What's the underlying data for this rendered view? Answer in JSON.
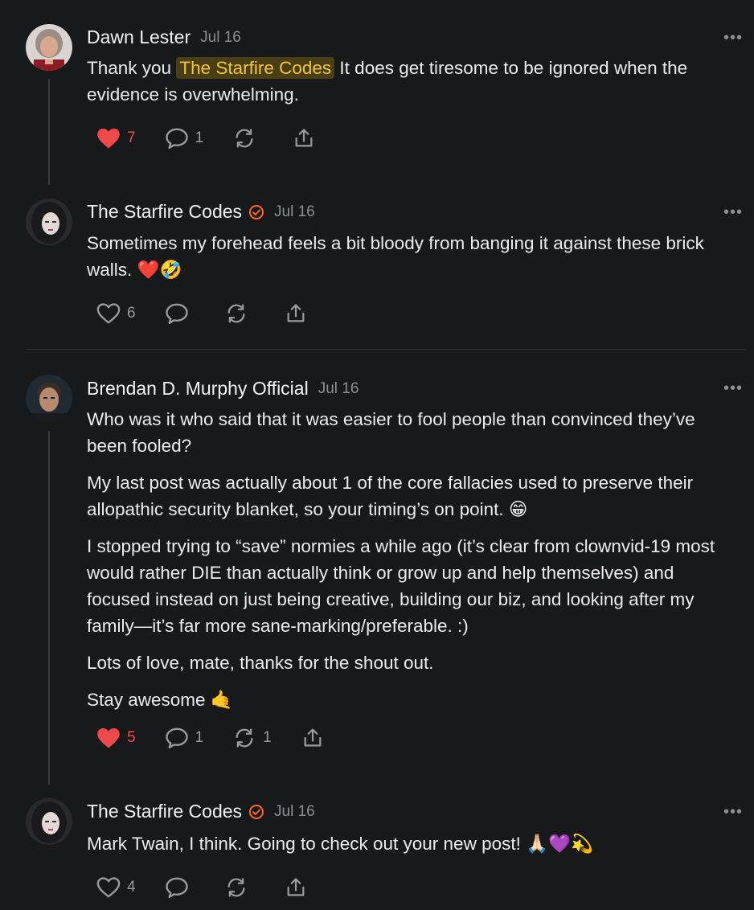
{
  "comments": [
    {
      "author": "Dawn Lester",
      "date": "Jul 16",
      "body_prefix": "Thank you ",
      "mention": "The Starfire Codes",
      "body_suffix": " It does get tiresome to be ignored when the evidence is overwhelming.",
      "likes": "7",
      "replies": "1",
      "restacks": "",
      "liked": true
    },
    {
      "author": "The Starfire Codes",
      "date": "Jul 16",
      "verified": true,
      "paragraphs": [
        "Sometimes my forehead feels a bit bloody from banging it against these brick walls. ❤️🤣"
      ],
      "likes": "6",
      "replies": "",
      "restacks": "",
      "liked": false
    },
    {
      "author": "Brendan D. Murphy Official",
      "date": "Jul 16",
      "paragraphs": [
        "Who was it who said that it was easier to fool people than convinced they’ve been fooled?",
        "My last post was actually about 1 of the core fallacies used to preserve their allopathic security blanket, so your timing’s on point. 😁",
        "I stopped trying to “save” normies a while ago (it’s clear from clownvid-19 most would rather DIE than actually think or grow up and help themselves) and focused instead on just being creative, building our biz, and looking after my family—it’s far more sane-marking/preferable. :)",
        "Lots of love, mate, thanks for the shout out.",
        "Stay awesome 🤙"
      ],
      "likes": "5",
      "replies": "1",
      "restacks": "1",
      "liked": true
    },
    {
      "author": "The Starfire Codes",
      "date": "Jul 16",
      "verified": true,
      "paragraphs": [
        "Mark Twain, I think. Going to check out your new post! 🙏🏻💜💫"
      ],
      "likes": "4",
      "replies": "",
      "restacks": "",
      "liked": false
    }
  ],
  "more_label": "•••",
  "colors": {
    "like_active": "#ef4a4a",
    "mention_bg": "#4a3f14",
    "mention_text": "#f0c53c",
    "verified": "#ff6719"
  }
}
